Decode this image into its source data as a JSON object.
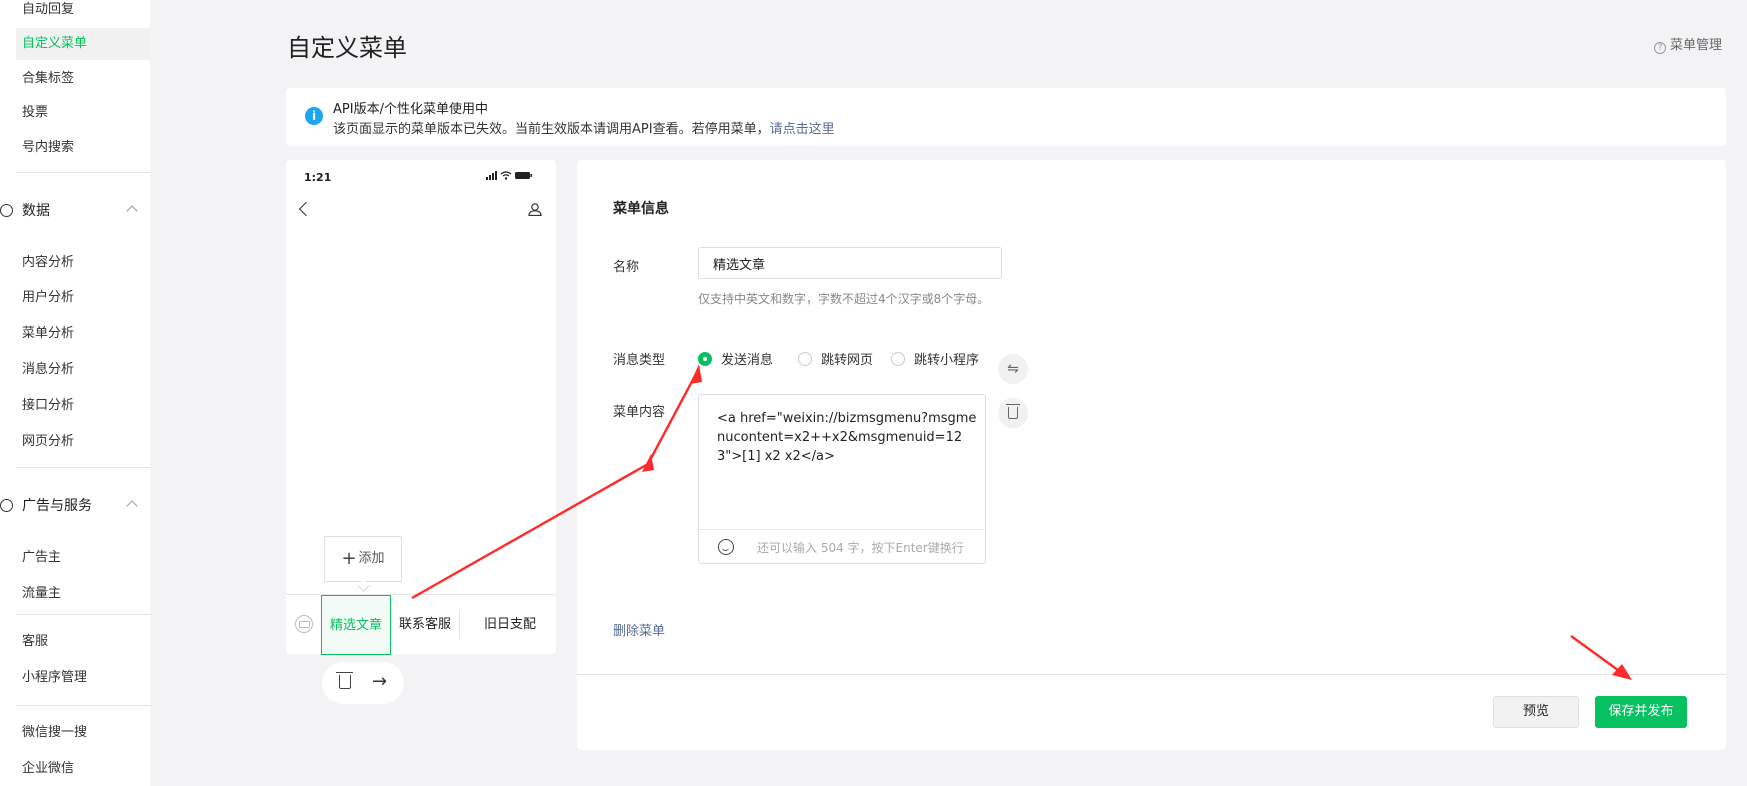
{
  "sidebar": {
    "top_items": [
      "自动回复",
      "自定义菜单",
      "合集标签",
      "投票",
      "号内搜索"
    ],
    "active_item": "自定义菜单",
    "data_section": {
      "label": "数据",
      "items": [
        "内容分析",
        "用户分析",
        "菜单分析",
        "消息分析",
        "接口分析",
        "网页分析"
      ]
    },
    "ad_section": {
      "label": "广告与服务",
      "items": [
        "广告主",
        "流量主"
      ]
    },
    "service_items": [
      "客服",
      "小程序管理"
    ],
    "bottom_items": [
      "微信搜一搜",
      "企业微信"
    ]
  },
  "header": {
    "title": "自定义菜单",
    "menu_manage": "菜单管理"
  },
  "notice": {
    "title": "API版本/个性化菜单使用中",
    "body": "该页面显示的菜单版本已失效。当前生效版本请调用API查看。若停用菜单，",
    "link": "请点击这里"
  },
  "phone": {
    "time": "1:21",
    "add_label": "添加",
    "menu_buttons": [
      "精选文章",
      "联系客服",
      "旧日支配"
    ],
    "active_menu": "精选文章"
  },
  "editor": {
    "section_title": "菜单信息",
    "name_label": "名称",
    "name_value": "精选文章",
    "name_tip": "仅支持中英文和数字，字数不超过4个汉字或8个字母。",
    "type_label": "消息类型",
    "type_options": [
      "发送消息",
      "跳转网页",
      "跳转小程序"
    ],
    "type_selected": "发送消息",
    "content_label": "菜单内容",
    "content_value": "<a href=\"weixin://bizmsgmenu?msgmenucontent=x2++x2&msgmenuid=123\">[1] x2  x2</a>",
    "counter": "还可以输入 504 字，按下Enter键换行",
    "delete_menu": "删除菜单",
    "preview_button": "预览",
    "publish_button": "保存并发布"
  },
  "colors": {
    "accent": "#07c160",
    "link": "#576b95",
    "info": "#1aa5f5",
    "annotation": "#ff2a2a"
  }
}
